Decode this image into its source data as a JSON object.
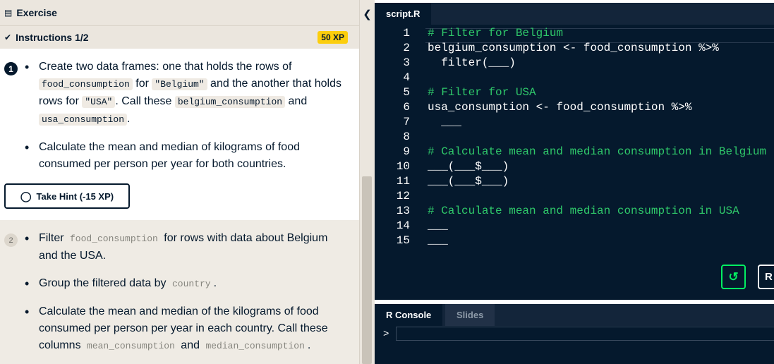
{
  "exercise": {
    "header_label": "Exercise"
  },
  "instructions": {
    "header_label": "Instructions 1/2",
    "xp": "50 XP"
  },
  "step1": {
    "number": "1",
    "bullet1": {
      "t1": "Create two data frames: one that holds the rows of",
      "c1": "food_consumption",
      "t2": " for ",
      "c2": "\"Belgium\"",
      "t3": " and the another that holds rows for ",
      "c3": "\"USA\"",
      "t4": ". Call these ",
      "c4": "belgium_consumption",
      "t5": " and ",
      "c5": "usa_consumption",
      "t6": "."
    },
    "bullet2": "Calculate the mean and median of kilograms of food consumed per person per year for both countries.",
    "hint_label": "Take Hint (-15 XP)"
  },
  "step2": {
    "number": "2",
    "bullet1": {
      "t1": "Filter ",
      "c1": "food_consumption",
      "t2": " for rows with data about Belgium and the USA."
    },
    "bullet2": {
      "t1": "Group the filtered data by ",
      "c1": "country",
      "t2": "."
    },
    "bullet3": {
      "t1": "Calculate the mean and median of the kilograms of food consumed per person per year in each country. Call these columns ",
      "c1": "mean_consumption",
      "t2": " and ",
      "c2": "median_consumption",
      "t3": "."
    }
  },
  "collapse_icon": "chevron-left-icon",
  "editor": {
    "tab_label": "script.R",
    "lines": [
      {
        "n": "1",
        "text": "# Filter for Belgium",
        "comment": true
      },
      {
        "n": "2",
        "text": "belgium_consumption <- food_consumption %>%",
        "comment": false
      },
      {
        "n": "3",
        "text": "  filter(___)",
        "comment": false
      },
      {
        "n": "4",
        "text": "",
        "comment": false
      },
      {
        "n": "5",
        "text": "# Filter for USA",
        "comment": true
      },
      {
        "n": "6",
        "text": "usa_consumption <- food_consumption %>%",
        "comment": false
      },
      {
        "n": "7",
        "text": "  ___",
        "comment": false
      },
      {
        "n": "8",
        "text": "",
        "comment": false
      },
      {
        "n": "9",
        "text": "# Calculate mean and median consumption in Belgium",
        "comment": true
      },
      {
        "n": "10",
        "text": "___(___$___)",
        "comment": false
      },
      {
        "n": "11",
        "text": "___(___$___)",
        "comment": false
      },
      {
        "n": "12",
        "text": "",
        "comment": false
      },
      {
        "n": "13",
        "text": "# Calculate mean and median consumption in USA",
        "comment": true
      },
      {
        "n": "14",
        "text": "___",
        "comment": false
      },
      {
        "n": "15",
        "text": "___",
        "comment": false
      }
    ],
    "reset_icon": "reset-icon",
    "run_label": "R"
  },
  "console": {
    "tabs": [
      "R Console",
      "Slides"
    ],
    "prompt": ">"
  },
  "colors": {
    "editor_bg": "#05192d",
    "comment": "#2fc86a",
    "xp_badge": "#fcce0d",
    "accent_green": "#03ef62"
  }
}
